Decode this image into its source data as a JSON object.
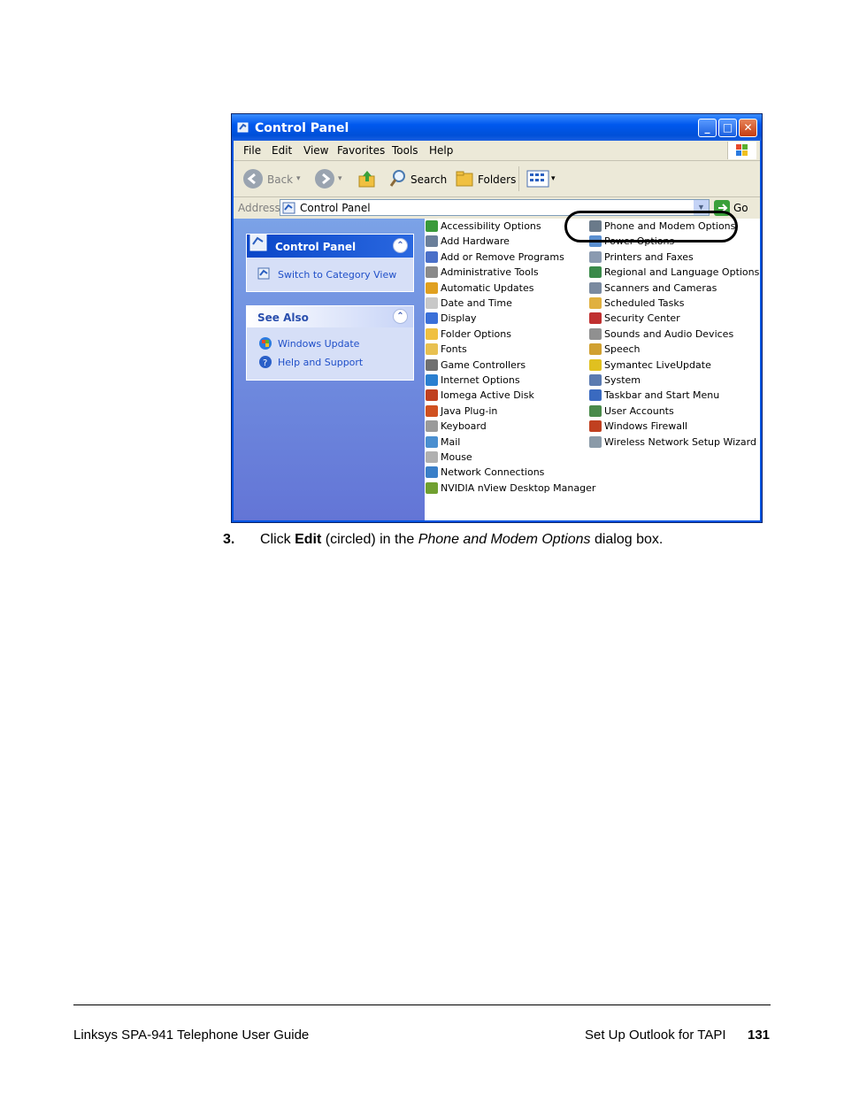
{
  "window": {
    "title": "Control Panel",
    "controls": {
      "minimize": "_",
      "maximize": "□",
      "close": "✕"
    }
  },
  "menu": [
    "File",
    "Edit",
    "View",
    "Favorites",
    "Tools",
    "Help"
  ],
  "toolbar": {
    "back": "Back",
    "search": "Search",
    "folders": "Folders"
  },
  "address": {
    "label": "Address",
    "value": "Control Panel",
    "go": "Go"
  },
  "sidebar": {
    "panel_title": "Control Panel",
    "switch_link": "Switch to Category View",
    "see_also_title": "See Also",
    "links": [
      "Windows Update",
      "Help and Support"
    ]
  },
  "items_left": [
    {
      "label": "Accessibility Options",
      "icon": "accessibility-icon",
      "color": "#3a9a3a"
    },
    {
      "label": "Add Hardware",
      "icon": "hardware-icon",
      "color": "#6a7f9a"
    },
    {
      "label": "Add or Remove Programs",
      "icon": "programs-icon",
      "color": "#4a6fc8"
    },
    {
      "label": "Administrative Tools",
      "icon": "admin-tools-icon",
      "color": "#8a8a8a"
    },
    {
      "label": "Automatic Updates",
      "icon": "updates-icon",
      "color": "#e0a020"
    },
    {
      "label": "Date and Time",
      "icon": "clock-icon",
      "color": "#c8c8c8"
    },
    {
      "label": "Display",
      "icon": "display-icon",
      "color": "#3a6fd8"
    },
    {
      "label": "Folder Options",
      "icon": "folder-icon",
      "color": "#f0c040"
    },
    {
      "label": "Fonts",
      "icon": "fonts-icon",
      "color": "#e8c050"
    },
    {
      "label": "Game Controllers",
      "icon": "gamepad-icon",
      "color": "#707070"
    },
    {
      "label": "Internet Options",
      "icon": "globe-icon",
      "color": "#2a7fd0"
    },
    {
      "label": "Iomega Active Disk",
      "icon": "disk-icon",
      "color": "#c04020"
    },
    {
      "label": "Java Plug-in",
      "icon": "java-icon",
      "color": "#d05020"
    },
    {
      "label": "Keyboard",
      "icon": "keyboard-icon",
      "color": "#9a9a9a"
    },
    {
      "label": "Mail",
      "icon": "mail-icon",
      "color": "#4a8fd0"
    },
    {
      "label": "Mouse",
      "icon": "mouse-icon",
      "color": "#b0b0b0"
    },
    {
      "label": "Network Connections",
      "icon": "network-icon",
      "color": "#3a7fc8"
    },
    {
      "label": "NVIDIA nView Desktop Manager",
      "icon": "nvidia-icon",
      "color": "#70a030"
    }
  ],
  "items_right": [
    {
      "label": "Phone and Modem Options",
      "icon": "phone-icon",
      "color": "#6a7a8a"
    },
    {
      "label": "Power Options",
      "icon": "power-icon",
      "color": "#5a8fd0"
    },
    {
      "label": "Printers and Faxes",
      "icon": "printer-icon",
      "color": "#8a9ab0"
    },
    {
      "label": "Regional and Language Options",
      "icon": "regional-icon",
      "color": "#3a8a4a"
    },
    {
      "label": "Scanners and Cameras",
      "icon": "scanner-icon",
      "color": "#7a8aa0"
    },
    {
      "label": "Scheduled Tasks",
      "icon": "tasks-icon",
      "color": "#e0b040"
    },
    {
      "label": "Security Center",
      "icon": "shield-icon",
      "color": "#c03030"
    },
    {
      "label": "Sounds and Audio Devices",
      "icon": "speaker-icon",
      "color": "#909090"
    },
    {
      "label": "Speech",
      "icon": "speech-icon",
      "color": "#d0a030"
    },
    {
      "label": "Symantec LiveUpdate",
      "icon": "liveupdate-icon",
      "color": "#e0c020"
    },
    {
      "label": "System",
      "icon": "system-icon",
      "color": "#5a7ab0"
    },
    {
      "label": "Taskbar and Start Menu",
      "icon": "taskbar-icon",
      "color": "#3a6ac0"
    },
    {
      "label": "User Accounts",
      "icon": "users-icon",
      "color": "#4a8a4a"
    },
    {
      "label": "Windows Firewall",
      "icon": "firewall-icon",
      "color": "#c04020"
    },
    {
      "label": "Wireless Network Setup Wizard",
      "icon": "wireless-icon",
      "color": "#8a9aa8"
    }
  ],
  "instruction": {
    "number": "3.",
    "p1": "Click ",
    "bold": "Edit",
    "p2": " (circled) in the ",
    "italic": "Phone and Modem Options",
    "p3": " dialog box."
  },
  "footer": {
    "left": "Linksys SPA-941 Telephone User Guide",
    "section": "Set Up Outlook for TAPI",
    "page": "131"
  }
}
